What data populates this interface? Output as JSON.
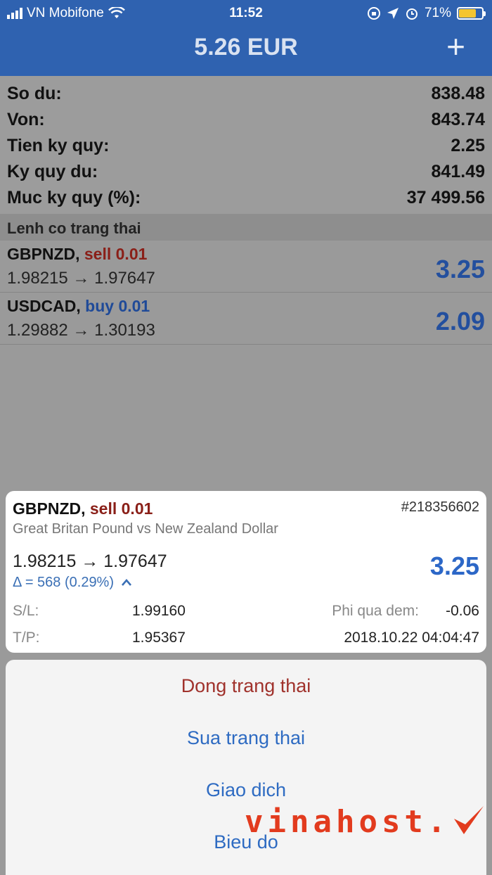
{
  "status_bar": {
    "carrier": "VN Mobifone",
    "time": "11:52",
    "battery": "71%",
    "battery_level": 0.71,
    "icons": [
      "signal-bars-icon",
      "wifi-icon",
      "orientation-lock-icon",
      "location-arrow-icon",
      "alarm-icon",
      "battery-icon"
    ]
  },
  "nav": {
    "title": "5.26 EUR",
    "add_icon": "plus-icon"
  },
  "account": [
    {
      "label": "So du:",
      "value": "838.48"
    },
    {
      "label": "Von:",
      "value": "843.74"
    },
    {
      "label": "Tien ky quy:",
      "value": "2.25"
    },
    {
      "label": "Ky quy du:",
      "value": "841.49"
    },
    {
      "label": "Muc ky quy (%):",
      "value": "37 499.56"
    }
  ],
  "section_title": "Lenh co trang thai",
  "positions": [
    {
      "symbol": "GBPNZD,",
      "side": "sell 0.01",
      "prices": "1.98215 → 1.97647",
      "profit": "3.25"
    },
    {
      "symbol": "USDCAD,",
      "side": "buy 0.01",
      "prices": "1.29882 → 1.30193",
      "profit": "2.09"
    }
  ],
  "detail": {
    "symbol": "GBPNZD,",
    "side": "sell 0.01",
    "ticket": "#218356602",
    "description": "Great Britan Pound vs New Zealand Dollar",
    "prices": "1.98215 → 1.97647",
    "delta": "Δ = 568 (0.29%)",
    "profit": "3.25",
    "sl_label": "S/L:",
    "sl_value": "1.99160",
    "tp_label": "T/P:",
    "tp_value": "1.95367",
    "swap_label": "Phi qua dem:",
    "swap_value": "-0.06",
    "open_time": "2018.10.22 04:04:47"
  },
  "actions": [
    {
      "label": "Dong trang thai",
      "color": "#a0322c"
    },
    {
      "label": "Sua trang thai",
      "color": "#2e6bc2"
    },
    {
      "label": "Giao dich",
      "color": "#2e6bc2"
    },
    {
      "label": "Bieu do",
      "color": "#2e6bc2"
    }
  ],
  "watermark": {
    "text": "vinahost.",
    "logo": "checkmark-logo-icon",
    "color": "#e23b1e"
  },
  "colors": {
    "nav_blue": "#2f62b0",
    "sell_red": "#8a1f18",
    "buy_blue": "#1f4a98",
    "profit_blue": "#2c67c7"
  }
}
